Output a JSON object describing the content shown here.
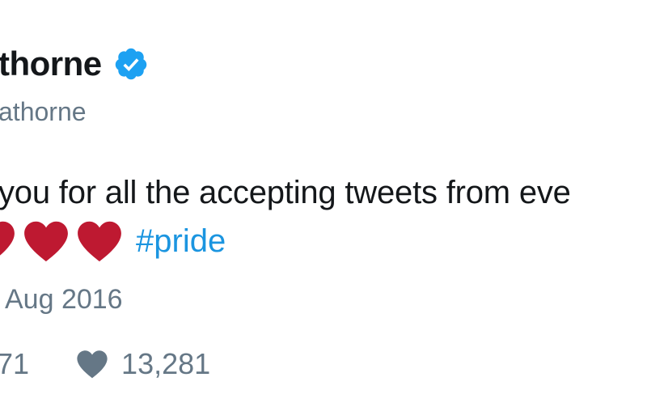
{
  "user": {
    "display_name": "thorne",
    "handle": "athorne",
    "verified_icon": "verified-badge-icon"
  },
  "tweet": {
    "text": "you for all the accepting tweets from eve",
    "emoji": [
      "red-heart-icon",
      "red-heart-icon",
      "red-heart-icon"
    ],
    "hashtag": "#pride",
    "date": "Aug 2016"
  },
  "stats": {
    "retweets": "71",
    "likes": "13,281",
    "like_icon": "heart-icon"
  },
  "colors": {
    "text": "#14171a",
    "muted": "#657786",
    "link": "#1b95e0",
    "verified": "#1da1f2",
    "heart": "#be1931"
  }
}
